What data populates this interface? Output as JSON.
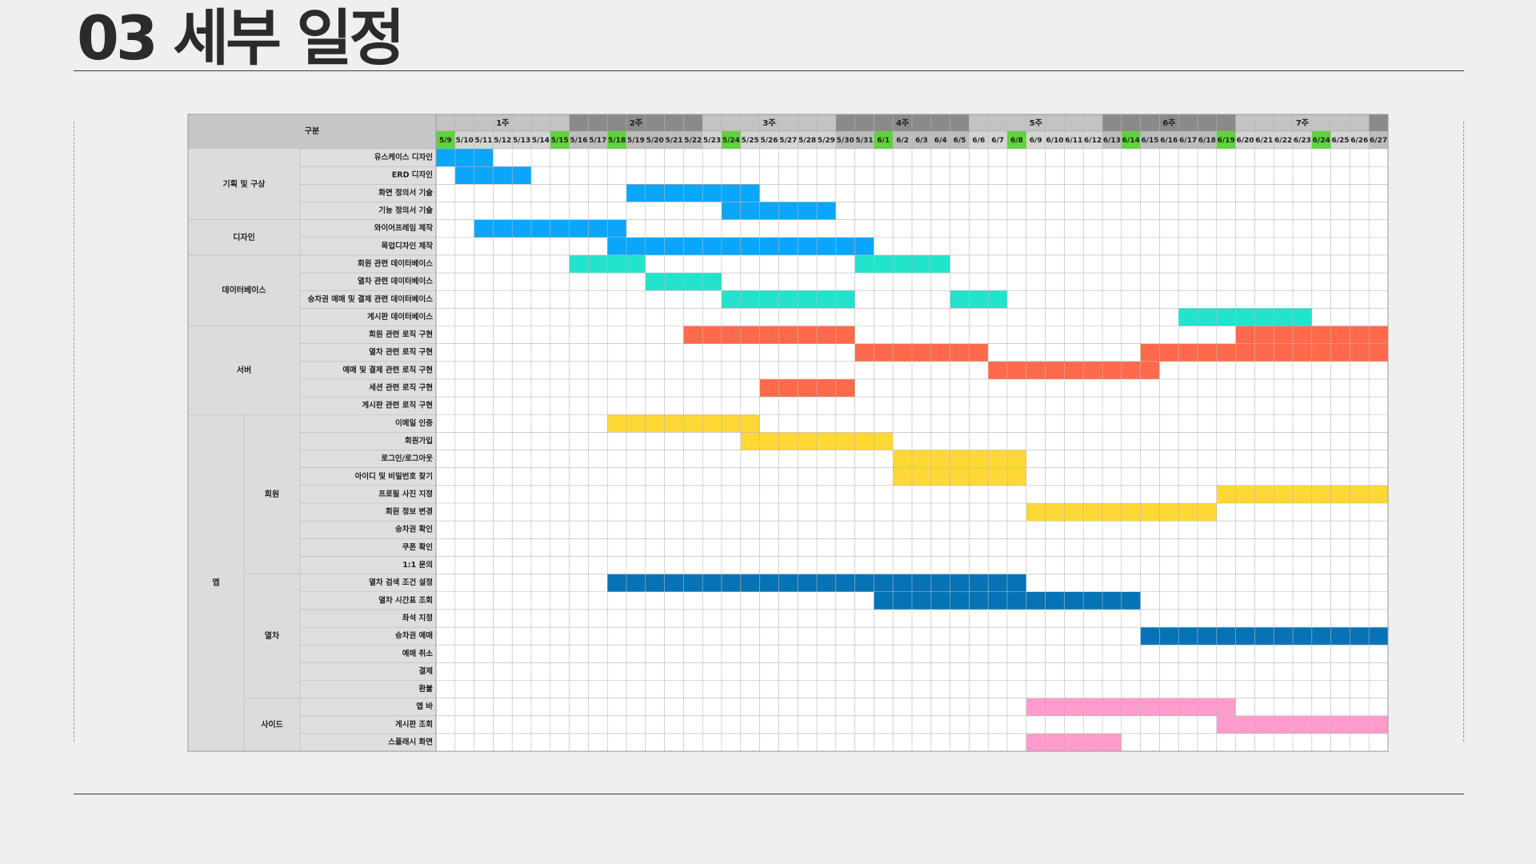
{
  "page": {
    "title": "03 세부 일정"
  },
  "chart_data": {
    "type": "gantt",
    "header_label": "구분",
    "weeks": [
      "1주",
      "2주",
      "3주",
      "4주",
      "5주",
      "6주",
      "7주",
      ""
    ],
    "dates": [
      "5/9",
      "5/10",
      "5/11",
      "5/12",
      "5/13",
      "5/14",
      "5/15",
      "5/16",
      "5/17",
      "5/18",
      "5/19",
      "5/20",
      "5/21",
      "5/22",
      "5/23",
      "5/24",
      "5/25",
      "5/26",
      "5/27",
      "5/28",
      "5/29",
      "5/30",
      "5/31",
      "6/1",
      "6/2",
      "6/3",
      "6/4",
      "6/5",
      "6/6",
      "6/7",
      "6/8",
      "6/9",
      "6/10",
      "6/11",
      "6/12",
      "6/13",
      "6/14",
      "6/15",
      "6/16",
      "6/17",
      "6/18",
      "6/19",
      "6/20",
      "6/21",
      "6/22",
      "6/23",
      "6/24",
      "6/25",
      "6/26",
      "6/27"
    ],
    "highlighted_dates": [
      "5/9",
      "5/15",
      "5/18",
      "5/24",
      "6/1",
      "6/8",
      "6/14",
      "6/19",
      "6/24"
    ],
    "colors": {
      "highlight": "#5fd33a",
      "planning": "#0aa6fb",
      "database": "#22e3cc",
      "server": "#ff6a4b",
      "app_member": "#ffd836",
      "app_train": "#0573b6",
      "app_side": "#ff9ccd"
    },
    "categories": [
      {
        "label": "기획 및 구상",
        "sub": null,
        "tasks": [
          {
            "name": "유스케이스 디자인",
            "color": "planning",
            "bars": [
              [
                "5/9",
                "5/11"
              ]
            ]
          },
          {
            "name": "ERD 디자인",
            "color": "planning",
            "bars": [
              [
                "5/10",
                "5/13"
              ]
            ]
          },
          {
            "name": "화면 정의서 기술",
            "color": "planning",
            "bars": [
              [
                "5/19",
                "5/25"
              ]
            ]
          },
          {
            "name": "기능 정의서 기술",
            "color": "planning",
            "bars": [
              [
                "5/24",
                "5/29"
              ]
            ]
          }
        ]
      },
      {
        "label": "디자인",
        "sub": null,
        "tasks": [
          {
            "name": "와이어프레임 제작",
            "color": "planning",
            "bars": [
              [
                "5/11",
                "5/18"
              ]
            ]
          },
          {
            "name": "목업디자인 제작",
            "color": "planning",
            "bars": [
              [
                "5/18",
                "5/31"
              ]
            ]
          }
        ]
      },
      {
        "label": "데이터베이스",
        "sub": null,
        "tasks": [
          {
            "name": "회원 관련 데이터베이스",
            "color": "database",
            "bars": [
              [
                "5/16",
                "5/19"
              ],
              [
                "5/31",
                "6/4"
              ]
            ]
          },
          {
            "name": "열차 관련 데이터베이스",
            "color": "database",
            "bars": [
              [
                "5/20",
                "5/23"
              ]
            ]
          },
          {
            "name": "승차권 예매 및 결제 관련 데이터베이스",
            "color": "database",
            "bars": [
              [
                "5/24",
                "5/30"
              ],
              [
                "6/5",
                "6/7"
              ]
            ]
          },
          {
            "name": "게시판 데이터베이스",
            "color": "database",
            "bars": [
              [
                "6/17",
                "6/23"
              ]
            ]
          }
        ]
      },
      {
        "label": "서버",
        "sub": null,
        "tasks": [
          {
            "name": "회원 관련 로직 구현",
            "color": "server",
            "bars": [
              [
                "5/22",
                "5/30"
              ],
              [
                "6/20",
                "6/27"
              ]
            ]
          },
          {
            "name": "열차 관련 로직 구현",
            "color": "server",
            "bars": [
              [
                "5/31",
                "6/6"
              ],
              [
                "6/15",
                "6/27"
              ]
            ]
          },
          {
            "name": "예매 및 결제 관련 로직 구현",
            "color": "server",
            "bars": [
              [
                "6/7",
                "6/15"
              ]
            ]
          },
          {
            "name": "세션 관련 로직 구현",
            "color": "server",
            "bars": [
              [
                "5/26",
                "5/30"
              ]
            ]
          },
          {
            "name": "게시판 관련 로직 구현",
            "color": "server",
            "bars": []
          }
        ]
      },
      {
        "label": "앱",
        "sub": [
          {
            "label": "회원",
            "tasks": [
              {
                "name": "이메일 인증",
                "color": "app_member",
                "bars": [
                  [
                    "5/18",
                    "5/25"
                  ]
                ]
              },
              {
                "name": "회원가입",
                "color": "app_member",
                "bars": [
                  [
                    "5/25",
                    "6/1"
                  ]
                ]
              },
              {
                "name": "로그인/로그아웃",
                "color": "app_member",
                "bars": [
                  [
                    "6/2",
                    "6/8"
                  ]
                ]
              },
              {
                "name": "아이디 및 비밀번호 찾기",
                "color": "app_member",
                "bars": [
                  [
                    "6/2",
                    "6/8"
                  ]
                ]
              },
              {
                "name": "프로필 사진 지정",
                "color": "app_member",
                "bars": [
                  [
                    "6/19",
                    "6/27"
                  ]
                ]
              },
              {
                "name": "회원 정보 변경",
                "color": "app_member",
                "bars": [
                  [
                    "6/9",
                    "6/18"
                  ]
                ]
              },
              {
                "name": "승차권 확인",
                "color": "app_member",
                "bars": []
              },
              {
                "name": "쿠폰 확인",
                "color": "app_member",
                "bars": []
              },
              {
                "name": "1:1 문의",
                "color": "app_member",
                "bars": []
              }
            ]
          },
          {
            "label": "열차",
            "tasks": [
              {
                "name": "열차 검색 조건 설정",
                "color": "app_train",
                "bars": [
                  [
                    "5/18",
                    "6/8"
                  ]
                ]
              },
              {
                "name": "열차 시간표 조회",
                "color": "app_train",
                "bars": [
                  [
                    "6/1",
                    "6/14"
                  ]
                ]
              },
              {
                "name": "좌석 지정",
                "color": "app_train",
                "bars": []
              },
              {
                "name": "승차권 예매",
                "color": "app_train",
                "bars": [
                  [
                    "6/15",
                    "6/27"
                  ]
                ]
              },
              {
                "name": "예매 취소",
                "color": "app_train",
                "bars": []
              },
              {
                "name": "결제",
                "color": "app_train",
                "bars": []
              },
              {
                "name": "환불",
                "color": "app_train",
                "bars": []
              }
            ]
          },
          {
            "label": "사이드",
            "tasks": [
              {
                "name": "앱 바",
                "color": "app_side",
                "bars": [
                  [
                    "6/9",
                    "6/19"
                  ]
                ]
              },
              {
                "name": "게시판 조회",
                "color": "app_side",
                "bars": [
                  [
                    "6/19",
                    "6/27"
                  ]
                ]
              },
              {
                "name": "스플래시 화면",
                "color": "app_side",
                "bars": [
                  [
                    "6/9",
                    "6/13"
                  ]
                ]
              }
            ]
          }
        ]
      }
    ]
  }
}
